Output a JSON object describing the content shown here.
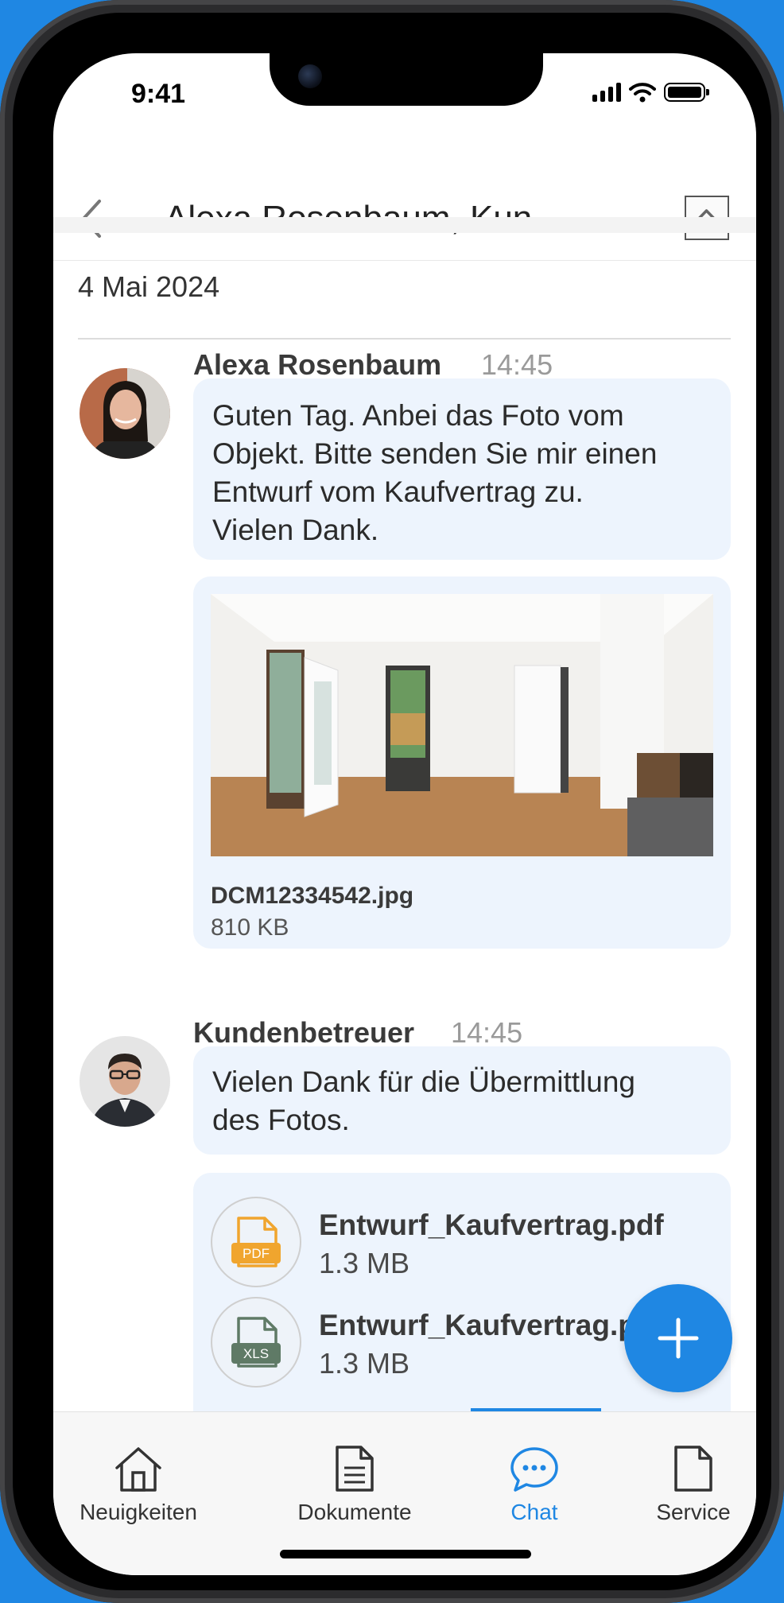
{
  "status_bar": {
    "time": "9:41"
  },
  "header": {
    "title": "Alexa Rosenbaum, Kunden..."
  },
  "chat": {
    "date": "4 Mai 2024",
    "messages": [
      {
        "sender": "Alexa Rosenbaum",
        "time": "14:45",
        "text_lines": [
          "Guten Tag. Anbei das Foto vom",
          "Objekt. Bitte senden Sie mir einen",
          "Entwurf vom Kaufvertrag zu.",
          "Vielen Dank."
        ],
        "attachment": {
          "file_name": "DCM12334542.jpg",
          "file_size": "810 KB"
        }
      },
      {
        "sender": "Kundenbetreuer",
        "time": "14:45",
        "text_lines": [
          "Vielen Dank für die Übermittlung",
          "des Fotos."
        ],
        "files": [
          {
            "type_label": "PDF",
            "name": "Entwurf_Kaufvertrag.pdf",
            "size": "1.3 MB",
            "color": "#f0a52e"
          },
          {
            "type_label": "XLS",
            "name": "Entwurf_Kaufvertrag.pdf",
            "size": "1.3 MB",
            "color": "#5f7a66"
          }
        ]
      }
    ]
  },
  "tabbar": {
    "tabs": [
      {
        "label": "Neuigkeiten",
        "icon": "home-icon"
      },
      {
        "label": "Dokumente",
        "icon": "document-lines-icon"
      },
      {
        "label": "Chat",
        "icon": "chat-bubble-icon",
        "active": true
      },
      {
        "label": "Service",
        "icon": "document-icon"
      }
    ]
  },
  "colors": {
    "accent": "#1f87e3",
    "bubble": "#edf4fd"
  }
}
